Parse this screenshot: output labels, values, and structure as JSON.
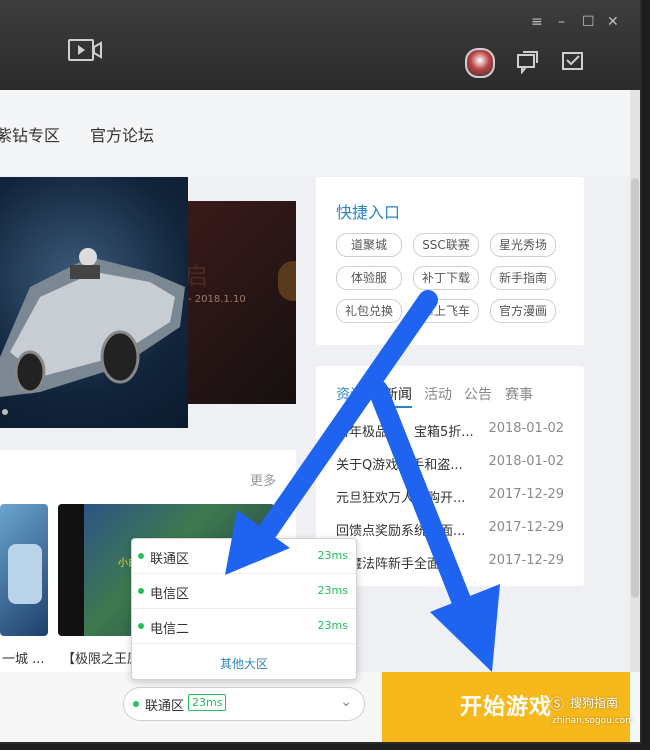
{
  "window": {
    "controls": [
      "≡",
      "–",
      "☐",
      "✕"
    ]
  },
  "header": {
    "icons": [
      "video-icon",
      "avatar",
      "chat-icon",
      "mail-icon"
    ]
  },
  "nav": {
    "items": [
      "紫钻专区",
      "官方论坛"
    ]
  },
  "banner": {
    "date_text": "- 2018.1.10"
  },
  "quick": {
    "title": "快捷入口",
    "tags": [
      "道聚城",
      "SSC联赛",
      "星光秀场",
      "体验服",
      "补丁下载",
      "新手指南",
      "礼包兑换",
      "掌上飞车",
      "官方漫画"
    ]
  },
  "news": {
    "tabs": [
      "资讯",
      "新闻",
      "活动",
      "公告",
      "赛事"
    ],
    "active_tab": 1,
    "rows": [
      {
        "title": "新年极品到，宝箱5折...",
        "date": "2018-01-02"
      },
      {
        "title": "关于Q游戏助手和盗...",
        "date": "2018-01-02"
      },
      {
        "title": "元旦狂欢万人团购开...",
        "date": "2017-12-29"
      },
      {
        "title": "回馈点奖励系统全面...",
        "date": "2017-12-29"
      },
      {
        "title": "古魔法阵新手全面...",
        "date": "2017-12-29"
      }
    ]
  },
  "videos": {
    "more_label": "更多",
    "thumb_text": "小白好厉害",
    "captions": [
      "一城 ...",
      "【极限之王原"
    ]
  },
  "server_popup": {
    "rows": [
      {
        "name": "联通区",
        "ping": "23ms"
      },
      {
        "name": "电信区",
        "ping": "23ms"
      },
      {
        "name": "电信二",
        "ping": "23ms"
      }
    ],
    "more_label": "其他大区"
  },
  "server_select": {
    "name": "联通区",
    "ping": "23ms"
  },
  "start_button": {
    "label": "开始游戏"
  },
  "watermark": {
    "brand": "搜狗指南",
    "url": "zhinan.sogou.com"
  },
  "colors": {
    "accent": "#2b86c5",
    "start": "#f6b81a",
    "ping": "#21c05a",
    "arrow": "#1e64f0"
  }
}
